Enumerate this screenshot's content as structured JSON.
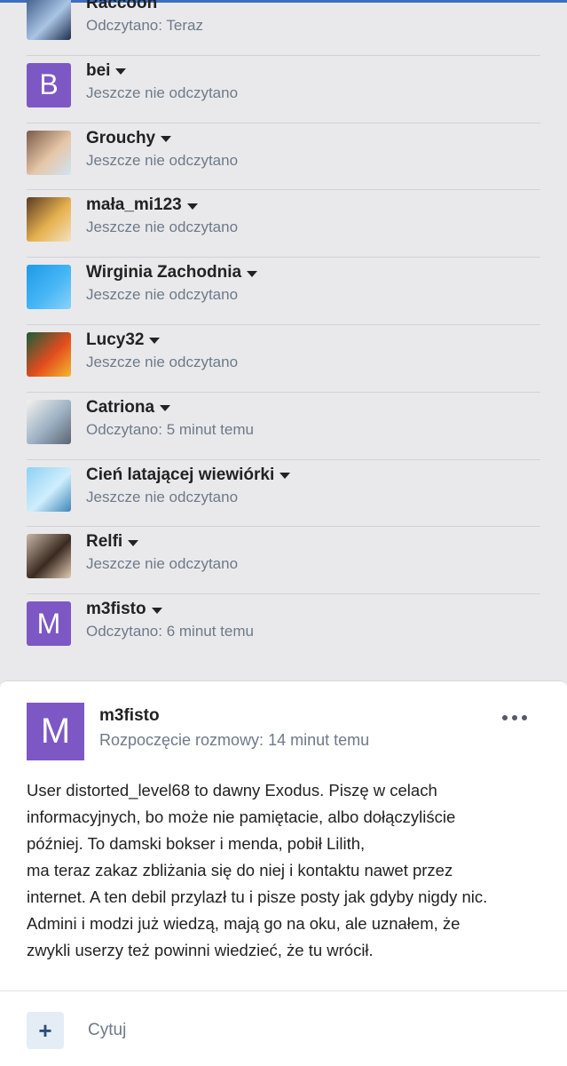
{
  "readers": [
    {
      "name": "Raccoon",
      "status": "Odczytano: Teraz",
      "has_menu": false,
      "avatar": {
        "type": "image",
        "colors": [
          "#3b5b86",
          "#a9c4e4",
          "#1d2e4a"
        ]
      }
    },
    {
      "name": "bei",
      "status": "Jeszcze nie odczytano",
      "has_menu": true,
      "avatar": {
        "type": "letter",
        "letter": "B"
      }
    },
    {
      "name": "Grouchy",
      "status": "Jeszcze nie odczytano",
      "has_menu": true,
      "avatar": {
        "type": "image",
        "colors": [
          "#7b5b49",
          "#e6c6a7",
          "#cfe4f2"
        ]
      }
    },
    {
      "name": "mała_mi123",
      "status": "Jeszcze nie odczytano",
      "has_menu": true,
      "avatar": {
        "type": "image",
        "colors": [
          "#5a3a22",
          "#e7b24f",
          "#f3e1bd"
        ]
      }
    },
    {
      "name": "Wirginia Zachodnia",
      "status": "Jeszcze nie odczytano",
      "has_menu": true,
      "avatar": {
        "type": "image",
        "colors": [
          "#1e9ae8",
          "#46b6f6",
          "#8ad2fb"
        ]
      }
    },
    {
      "name": "Lucy32",
      "status": "Jeszcze nie odczytano",
      "has_menu": true,
      "avatar": {
        "type": "image",
        "colors": [
          "#1a5d3a",
          "#e34c1d",
          "#f4b82d"
        ]
      }
    },
    {
      "name": "Catriona",
      "status": "Odczytano: 5 minut temu",
      "has_menu": true,
      "avatar": {
        "type": "image",
        "colors": [
          "#f4f2ee",
          "#9bb0c2",
          "#5a6470"
        ]
      }
    },
    {
      "name": "Cień latającej wiewiórki",
      "status": "Jeszcze nie odczytano",
      "has_menu": true,
      "avatar": {
        "type": "image",
        "colors": [
          "#8fd0f4",
          "#cfeefd",
          "#3e86b6"
        ]
      }
    },
    {
      "name": "Relfi",
      "status": "Jeszcze nie odczytano",
      "has_menu": true,
      "avatar": {
        "type": "image",
        "colors": [
          "#c8b7a6",
          "#3a2a20",
          "#e4cdb6"
        ]
      }
    },
    {
      "name": "m3fisto",
      "status": "Odczytano: 6 minut temu",
      "has_menu": true,
      "avatar": {
        "type": "letter",
        "letter": "M"
      }
    }
  ],
  "post": {
    "avatar_letter": "M",
    "author": "m3fisto",
    "started": "Rozpoczęcie rozmowy: 14 minut temu",
    "body_lines": [
      "User distorted_level68 to dawny Exodus. Piszę w celach",
      "informacyjnych, bo może nie pamiętacie, albo dołączyliście",
      "później. To damski bokser i menda, pobił Lilith,",
      "ma teraz zakaz zbliżania się do niej i kontaktu nawet przez",
      "internet. A ten debil przylazł tu i pisze posty jak gdyby nigdy nic.",
      "Admini i modzi już wiedzą, mają go na oku, ale uznałem, że",
      "zwykli userzy też powinni wiedzieć, że tu wrócił."
    ],
    "quote_icon": "+",
    "quote_label": "Cytuj"
  },
  "colors": {
    "accent": "#3c6fbf",
    "letter_avatar": "#7d58c4",
    "muted_text": "#6e7a88",
    "list_background": "#e9e9ec"
  }
}
